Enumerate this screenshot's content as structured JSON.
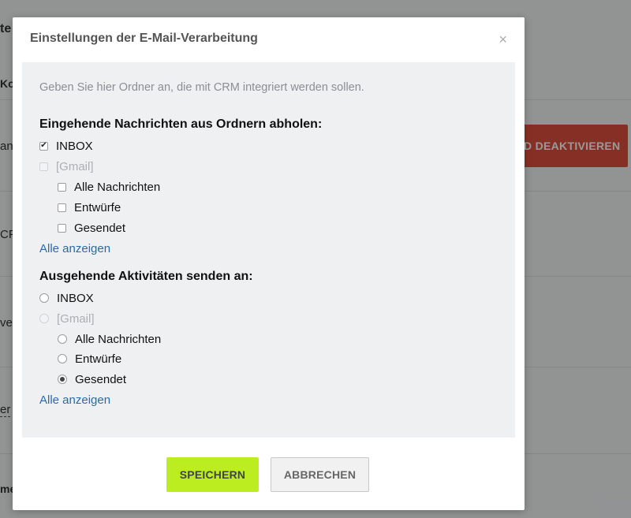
{
  "background": {
    "fragments": [
      "te",
      "Ko",
      "an",
      "CF",
      "ve",
      "er",
      "me"
    ],
    "deactivate_label": "D DEAKTIVIEREN"
  },
  "modal": {
    "title": "Einstellungen der E-Mail-Verarbeitung",
    "close_glyph": "×",
    "hint": "Geben Sie hier Ordner an, die mit CRM integriert werden sollen.",
    "incoming": {
      "title": "Eingehende Nachrichten aus Ordnern abholen:",
      "options": [
        {
          "label": "INBOX",
          "checked": true,
          "disabled": false
        },
        {
          "label": "[Gmail]",
          "checked": false,
          "disabled": true
        },
        {
          "label": "Alle Nachrichten",
          "checked": false,
          "disabled": false
        },
        {
          "label": "Entwürfe",
          "checked": false,
          "disabled": false
        },
        {
          "label": "Gesendet",
          "checked": false,
          "disabled": false
        }
      ],
      "show_all": "Alle anzeigen"
    },
    "outgoing": {
      "title": "Ausgehende Aktivitäten senden an:",
      "options": [
        {
          "label": "INBOX",
          "selected": false,
          "disabled": false
        },
        {
          "label": "[Gmail]",
          "selected": false,
          "disabled": true
        },
        {
          "label": "Alle Nachrichten",
          "selected": false,
          "disabled": false
        },
        {
          "label": "Entwürfe",
          "selected": false,
          "disabled": false
        },
        {
          "label": "Gesendet",
          "selected": true,
          "disabled": false
        }
      ],
      "show_all": "Alle anzeigen"
    },
    "save_label": "SPEICHERN",
    "cancel_label": "ABBRECHEN"
  },
  "colors": {
    "save_button": "#bbed21",
    "deactivate_button": "#e0513f",
    "link": "#2b6aa8"
  }
}
